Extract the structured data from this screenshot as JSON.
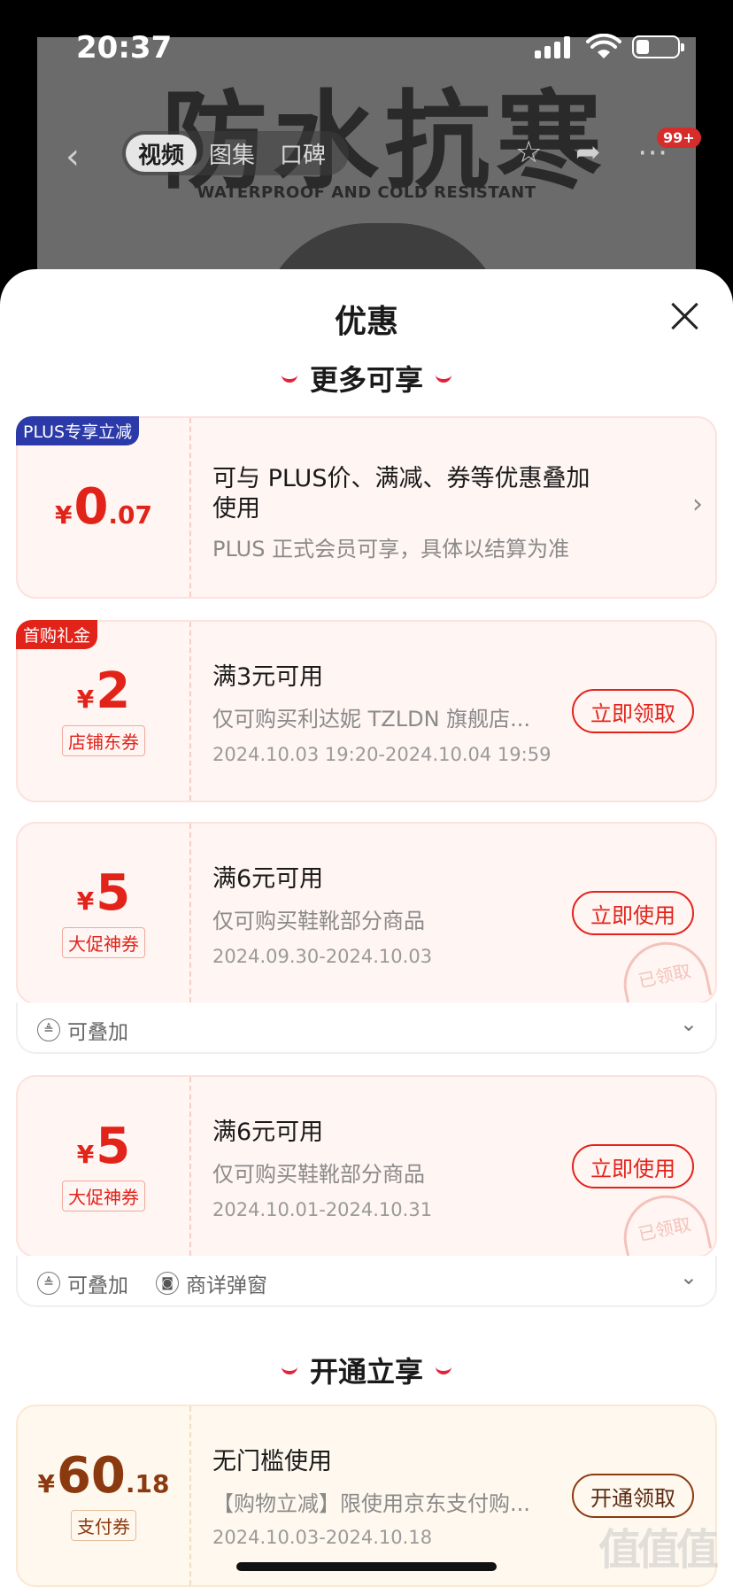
{
  "status": {
    "time": "20:37"
  },
  "product": {
    "headline": "防水抗寒",
    "subline": "WATERPROOF AND COLD RESISTANT"
  },
  "nav": {
    "tabs": [
      "视频",
      "图集",
      "口碑"
    ],
    "badge": "99+"
  },
  "sheet": {
    "title": "优惠",
    "section1": "更多可享",
    "section2": "开通立享"
  },
  "coupons": [
    {
      "corner": "PLUS专享立减",
      "cur": "¥",
      "int": "0",
      "dec": ".07",
      "line1a": "可与 PLUS价、满减、券等优惠叠加",
      "line1b": "使用",
      "line2": "PLUS 正式会员可享，具体以结算为准"
    },
    {
      "corner": "首购礼金",
      "cur": "¥",
      "int": "2",
      "dec": "",
      "tag": "店铺东券",
      "line1": "满3元可用",
      "line2": "仅可购买利达妮 TZLDN 旗舰店...",
      "line3": "2024.10.03 19:20-2024.10.04 19:59",
      "button": "立即领取"
    },
    {
      "cur": "¥",
      "int": "5",
      "dec": "",
      "tag": "大促神券",
      "line1": "满6元可用",
      "line2": "仅可购买鞋靴部分商品",
      "line3": "2024.09.30-2024.10.03",
      "button": "立即使用",
      "stamp": "已领取",
      "foot": [
        "可叠加"
      ]
    },
    {
      "cur": "¥",
      "int": "5",
      "dec": "",
      "tag": "大促神券",
      "line1": "满6元可用",
      "line2": "仅可购买鞋靴部分商品",
      "line3": "2024.10.01-2024.10.31",
      "button": "立即使用",
      "stamp": "已领取",
      "foot": [
        "可叠加",
        "商详弹窗"
      ]
    },
    {
      "cur": "¥",
      "int": "60",
      "dec": ".18",
      "tag": "支付券",
      "line1": "无门槛使用",
      "line2": "【购物立减】限使用京东支付购...",
      "line3": "2024.10.03-2024.10.18",
      "button": "开通领取"
    }
  ],
  "watermark": "值值值",
  "colors": {
    "accent": "#e2231a",
    "plus_blue": "#2b3aa8",
    "gold_text": "#8b3a10"
  }
}
